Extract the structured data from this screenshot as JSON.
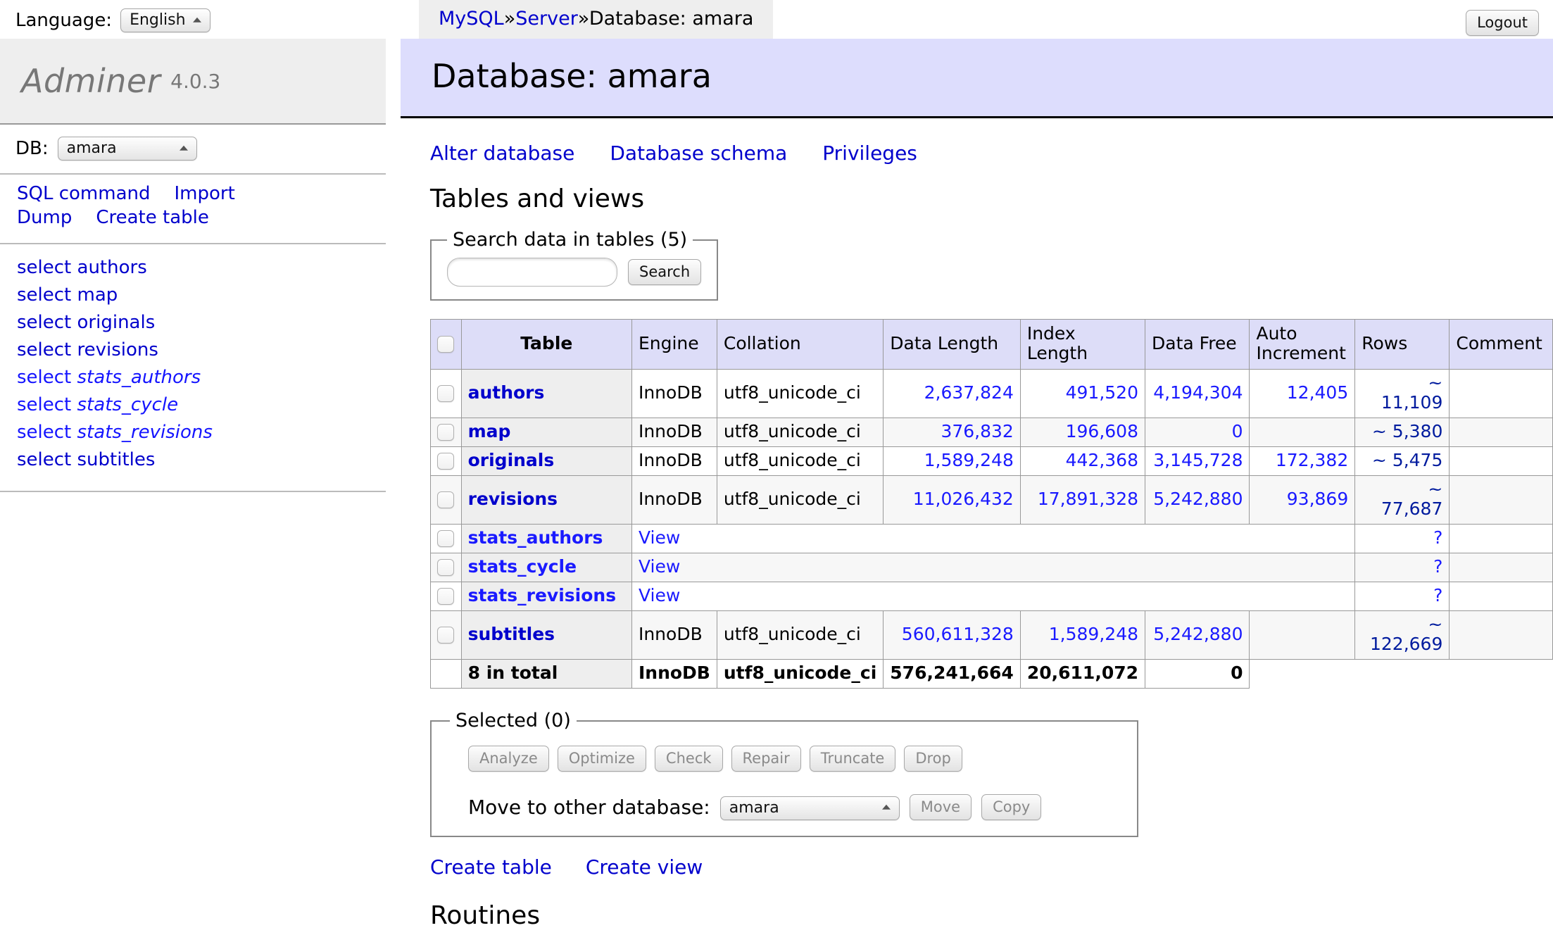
{
  "topbar": {
    "language_label": "Language:",
    "language_value": "English",
    "breadcrumb": {
      "driver": "MySQL",
      "server": "Server",
      "current": "Database: amara",
      "separator": "»"
    },
    "logout_label": "Logout"
  },
  "sidebar": {
    "logo_name": "Adminer",
    "logo_version": "4.0.3",
    "db_label": "DB:",
    "db_value": "amara",
    "menu": [
      {
        "label": "SQL command"
      },
      {
        "label": "Import"
      },
      {
        "label": "Dump"
      },
      {
        "label": "Create table"
      }
    ],
    "select_prefix": "select",
    "select_links": [
      {
        "name": "authors",
        "is_view": false
      },
      {
        "name": "map",
        "is_view": false
      },
      {
        "name": "originals",
        "is_view": false
      },
      {
        "name": "revisions",
        "is_view": false
      },
      {
        "name": "stats_authors",
        "is_view": true
      },
      {
        "name": "stats_cycle",
        "is_view": true
      },
      {
        "name": "stats_revisions",
        "is_view": true
      },
      {
        "name": "subtitles",
        "is_view": false
      }
    ]
  },
  "main": {
    "page_title": "Database: amara",
    "top_links": [
      {
        "label": "Alter database"
      },
      {
        "label": "Database schema"
      },
      {
        "label": "Privileges"
      }
    ],
    "tables_heading": "Tables and views",
    "search": {
      "legend": "Search data in tables (5)",
      "value": "",
      "placeholder": "",
      "button_label": "Search"
    },
    "table": {
      "headers": [
        "",
        "Table",
        "Engine",
        "Collation",
        "Data Length",
        "Index Length",
        "Data Free",
        "Auto Increment",
        "Rows",
        "Comment"
      ],
      "rows": [
        {
          "name": "authors",
          "is_view": false,
          "engine": "InnoDB",
          "collation": "utf8_unicode_ci",
          "data_length": "2,637,824",
          "index_length": "491,520",
          "data_free": "4,194,304",
          "auto_increment": "12,405",
          "rows": "~ 11,109",
          "comment": ""
        },
        {
          "name": "map",
          "is_view": false,
          "engine": "InnoDB",
          "collation": "utf8_unicode_ci",
          "data_length": "376,832",
          "index_length": "196,608",
          "data_free": "0",
          "auto_increment": "",
          "rows": "~ 5,380",
          "comment": ""
        },
        {
          "name": "originals",
          "is_view": false,
          "engine": "InnoDB",
          "collation": "utf8_unicode_ci",
          "data_length": "1,589,248",
          "index_length": "442,368",
          "data_free": "3,145,728",
          "auto_increment": "172,382",
          "rows": "~ 5,475",
          "comment": ""
        },
        {
          "name": "revisions",
          "is_view": false,
          "engine": "InnoDB",
          "collation": "utf8_unicode_ci",
          "data_length": "11,026,432",
          "index_length": "17,891,328",
          "data_free": "5,242,880",
          "auto_increment": "93,869",
          "rows": "~ 77,687",
          "comment": ""
        },
        {
          "name": "stats_authors",
          "is_view": true,
          "view_label": "View",
          "rows": "?",
          "comment": ""
        },
        {
          "name": "stats_cycle",
          "is_view": true,
          "view_label": "View",
          "rows": "?",
          "comment": ""
        },
        {
          "name": "stats_revisions",
          "is_view": true,
          "view_label": "View",
          "rows": "?",
          "comment": ""
        },
        {
          "name": "subtitles",
          "is_view": false,
          "engine": "InnoDB",
          "collation": "utf8_unicode_ci",
          "data_length": "560,611,328",
          "index_length": "1,589,248",
          "data_free": "5,242,880",
          "auto_increment": "",
          "rows": "~ 122,669",
          "comment": ""
        }
      ],
      "total": {
        "label": "8 in total",
        "engine": "InnoDB",
        "collation": "utf8_unicode_ci",
        "data_length": "576,241,664",
        "index_length": "20,611,072",
        "data_free": "0"
      }
    },
    "selected": {
      "legend": "Selected (0)",
      "buttons": [
        {
          "label": "Analyze"
        },
        {
          "label": "Optimize"
        },
        {
          "label": "Check"
        },
        {
          "label": "Repair"
        },
        {
          "label": "Truncate"
        },
        {
          "label": "Drop"
        }
      ],
      "move_label": "Move to other database:",
      "move_db_value": "amara",
      "move_button": "Move",
      "copy_button": "Copy"
    },
    "bottom_links": [
      {
        "label": "Create table"
      },
      {
        "label": "Create view"
      }
    ],
    "routines_heading": "Routines"
  }
}
